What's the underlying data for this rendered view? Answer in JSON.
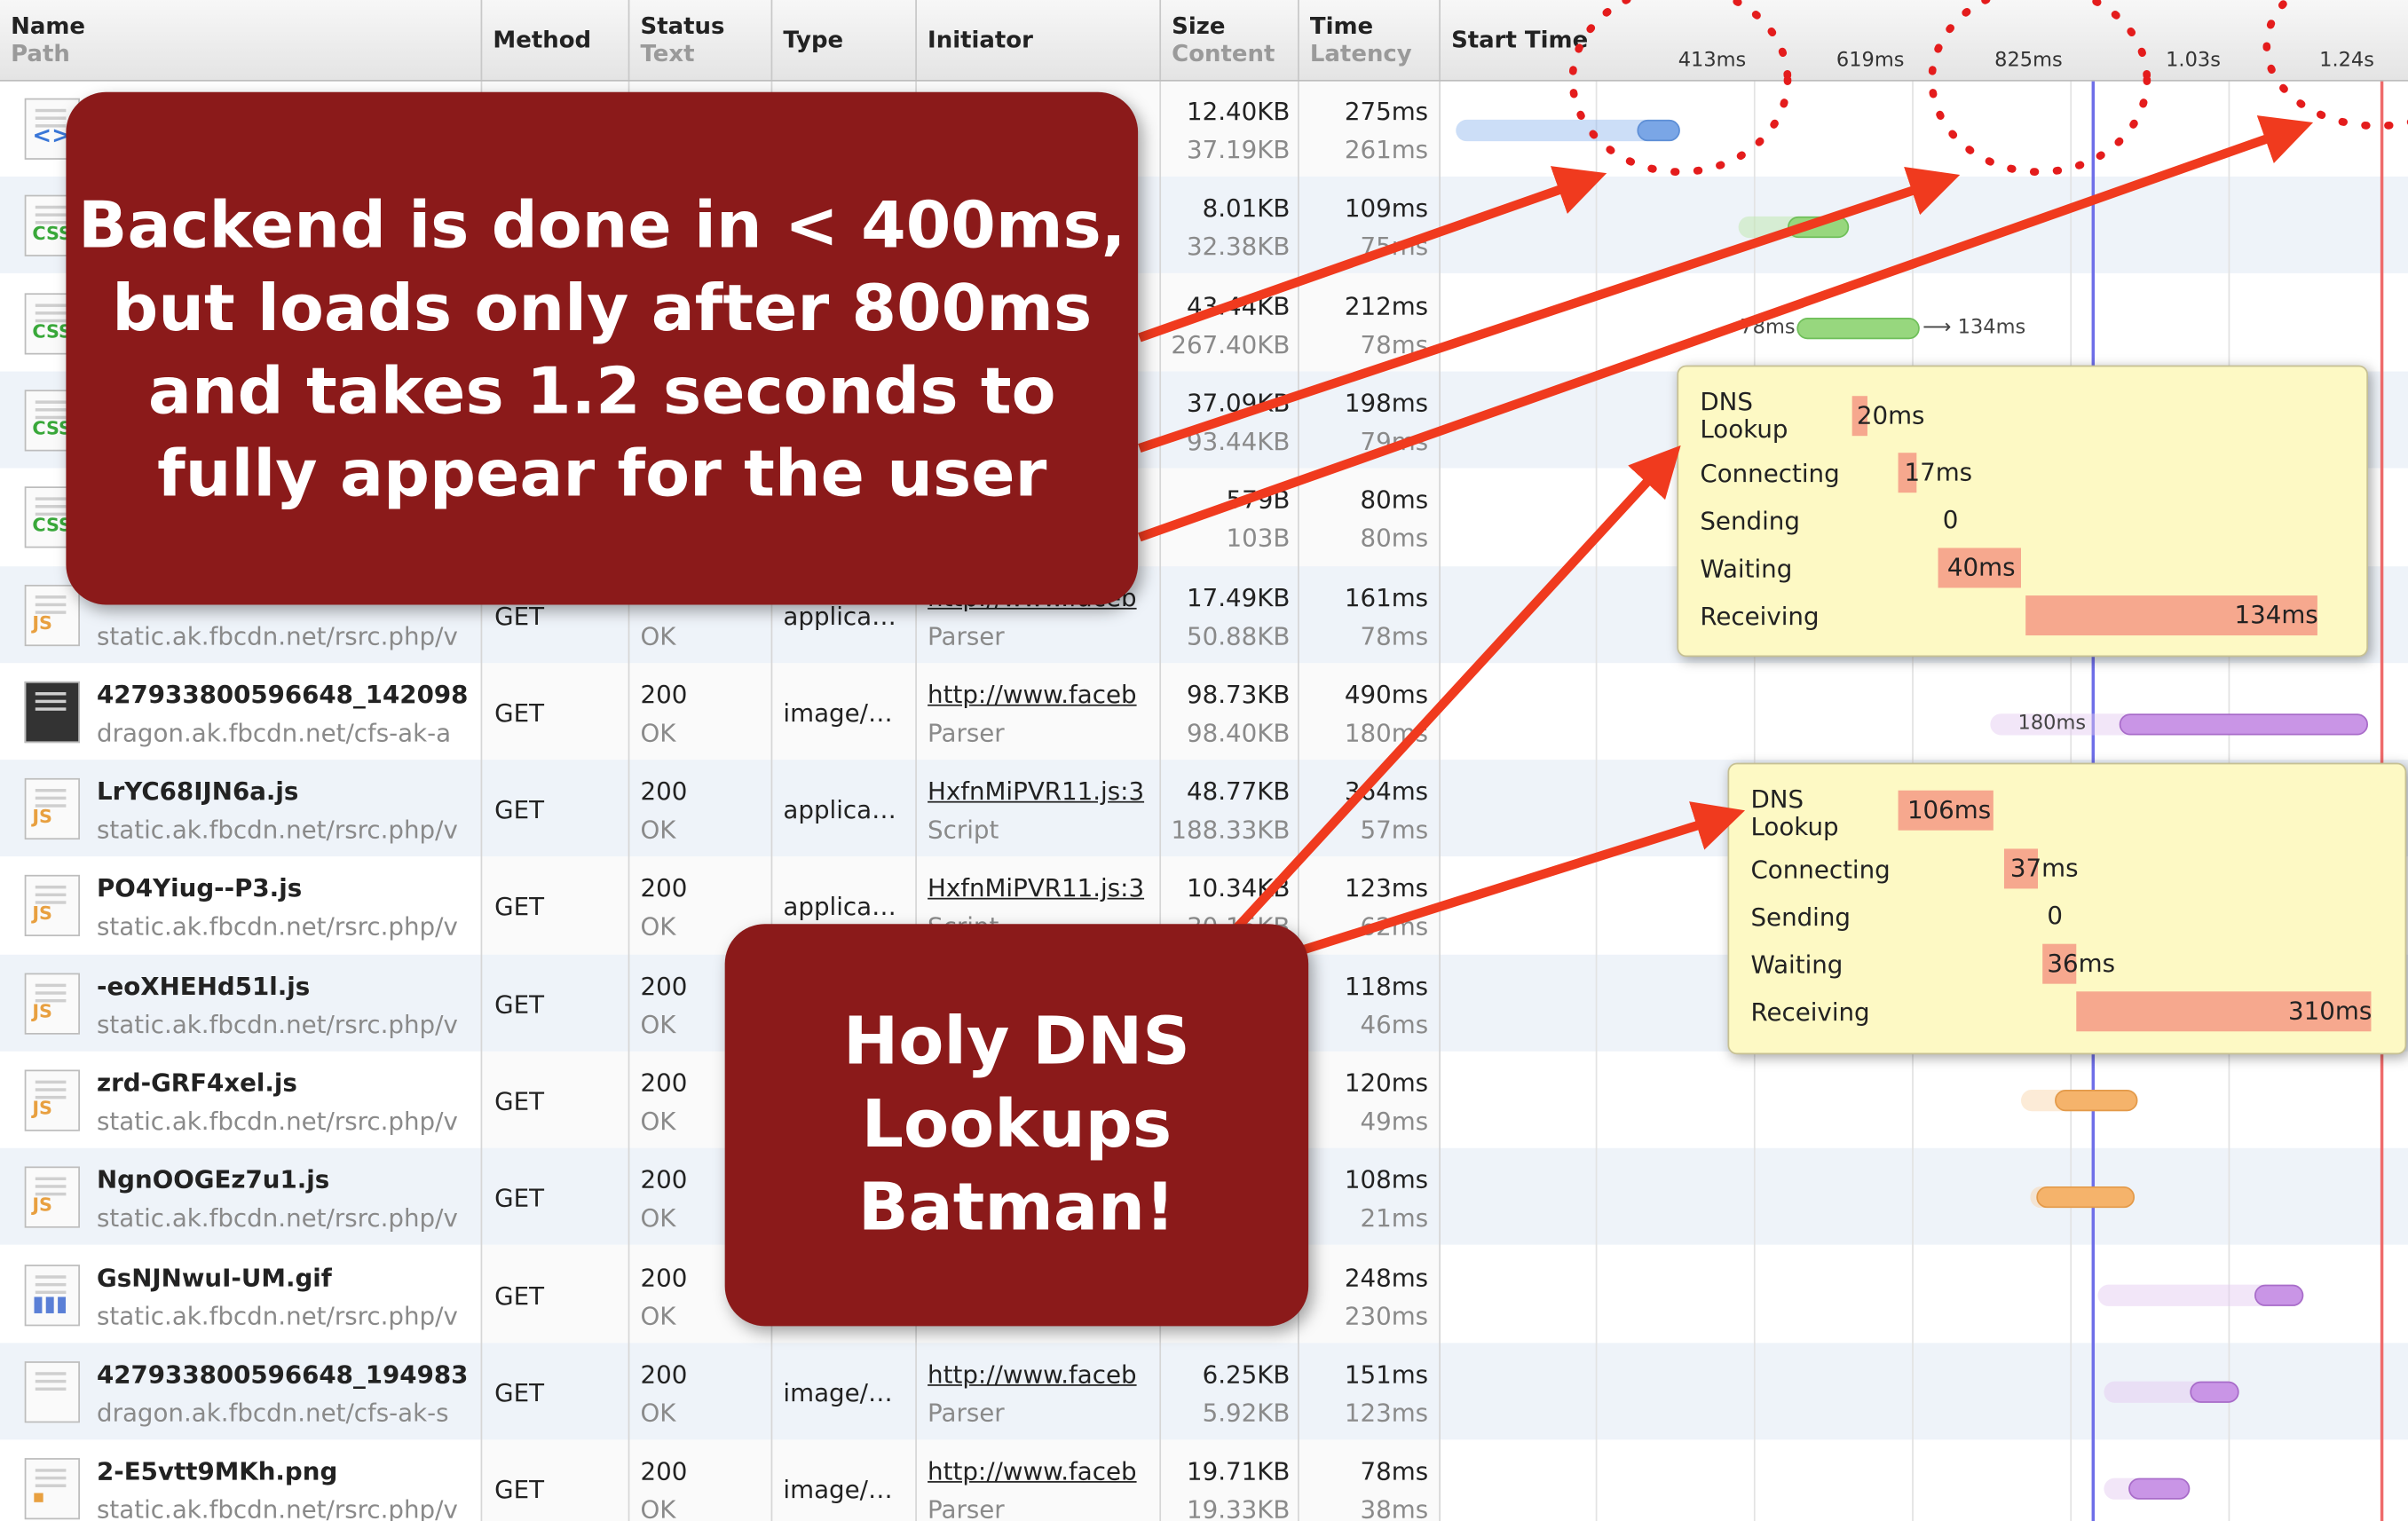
{
  "header": {
    "name": "Name",
    "path": "Path",
    "method": "Method",
    "status": "Status",
    "status_text": "Text",
    "type": "Type",
    "initiator": "Initiator",
    "size": "Size",
    "content": "Content",
    "time": "Time",
    "latency": "Latency",
    "start_time": "Start Time",
    "ticks": [
      "413ms",
      "619ms",
      "825ms",
      "1.03s",
      "1.24s"
    ]
  },
  "rows": [
    {
      "icon": "html-file-icon",
      "name": "",
      "path": "",
      "method": "",
      "status": "",
      "status_text": "",
      "type": "",
      "init1": "",
      "init2": "",
      "size": "12.40KB",
      "content": "37.19KB",
      "time": "275ms",
      "latency": "261ms"
    },
    {
      "icon": "css-file-icon",
      "name": "",
      "path": "",
      "method": "",
      "status": "",
      "status_text": "",
      "type": "",
      "init1": "",
      "init2": "",
      "size": "8.01KB",
      "content": "32.38KB",
      "time": "109ms",
      "latency": "75ms"
    },
    {
      "icon": "css-file-icon",
      "name": "",
      "path": "",
      "method": "",
      "status": "",
      "status_text": "",
      "type": "",
      "init1": "",
      "init2": "",
      "size": "43.44KB",
      "content": "267.40KB",
      "time": "212ms",
      "latency": "78ms"
    },
    {
      "icon": "css-file-icon",
      "name": "",
      "path": "",
      "method": "",
      "status": "",
      "status_text": "",
      "type": "",
      "init1": "",
      "init2": "",
      "size": "37.09KB",
      "content": "93.44KB",
      "time": "198ms",
      "latency": "79ms"
    },
    {
      "icon": "css-file-icon",
      "name": "",
      "path": "",
      "method": "",
      "status": "",
      "status_text": "",
      "type": "",
      "init1": "",
      "init2": "",
      "size": "579B",
      "content": "103B",
      "time": "80ms",
      "latency": "80ms"
    },
    {
      "icon": "js-file-icon",
      "name": "",
      "path": "static.ak.fbcdn.net/rsrc.php/v",
      "method": "GET",
      "status": "",
      "status_text": "OK",
      "type": "applica…",
      "init1": "http://www.faceb",
      "init2": "Parser",
      "size": "17.49KB",
      "content": "50.88KB",
      "time": "161ms",
      "latency": "78ms"
    },
    {
      "icon": "image-file-icon",
      "name": "427933800596648_142098",
      "path": "dragon.ak.fbcdn.net/cfs-ak-a",
      "method": "GET",
      "status": "200",
      "status_text": "OK",
      "type": "image/…",
      "init1": "http://www.faceb",
      "init2": "Parser",
      "size": "98.73KB",
      "content": "98.40KB",
      "time": "490ms",
      "latency": "180ms"
    },
    {
      "icon": "js-file-icon",
      "name": "LrYC68IJN6a.js",
      "path": "static.ak.fbcdn.net/rsrc.php/v",
      "method": "GET",
      "status": "200",
      "status_text": "OK",
      "type": "applica…",
      "init1": "HxfnMiPVR11.js:3",
      "init2": "Script",
      "size": "48.77KB",
      "content": "188.33KB",
      "time": "364ms",
      "latency": "57ms"
    },
    {
      "icon": "js-file-icon",
      "name": "PO4Yiug--P3.js",
      "path": "static.ak.fbcdn.net/rsrc.php/v",
      "method": "GET",
      "status": "200",
      "status_text": "OK",
      "type": "applica…",
      "init1": "HxfnMiPVR11.js:3",
      "init2": "Script",
      "size": "10.34KB",
      "content": "30.15KB",
      "time": "123ms",
      "latency": "62ms"
    },
    {
      "icon": "js-file-icon",
      "name": "-eoXHEHd51l.js",
      "path": "static.ak.fbcdn.net/rsrc.php/v",
      "method": "GET",
      "status": "200",
      "status_text": "OK",
      "type": "",
      "init1": "",
      "init2": "",
      "size": "",
      "content": "",
      "time": "118ms",
      "latency": "46ms"
    },
    {
      "icon": "js-file-icon",
      "name": "zrd-GRF4xel.js",
      "path": "static.ak.fbcdn.net/rsrc.php/v",
      "method": "GET",
      "status": "200",
      "status_text": "OK",
      "type": "",
      "init1": "",
      "init2": "",
      "size": "",
      "content": "",
      "time": "120ms",
      "latency": "49ms"
    },
    {
      "icon": "js-file-icon",
      "name": "NgnOOGEz7u1.js",
      "path": "static.ak.fbcdn.net/rsrc.php/v",
      "method": "GET",
      "status": "200",
      "status_text": "OK",
      "type": "",
      "init1": "",
      "init2": "",
      "size": "",
      "content": "",
      "time": "108ms",
      "latency": "21ms"
    },
    {
      "icon": "gif-file-icon",
      "name": "GsNJNwuI-UM.gif",
      "path": "static.ak.fbcdn.net/rsrc.php/v",
      "method": "GET",
      "status": "200",
      "status_text": "OK",
      "type": "",
      "init1": "",
      "init2": "",
      "size": "",
      "content": "",
      "time": "248ms",
      "latency": "230ms"
    },
    {
      "icon": "blank-file-icon",
      "name": "427933800596648_194983",
      "path": "dragon.ak.fbcdn.net/cfs-ak-s",
      "method": "GET",
      "status": "200",
      "status_text": "OK",
      "type": "image/…",
      "init1": "http://www.faceb",
      "init2": "Parser",
      "size": "6.25KB",
      "content": "5.92KB",
      "time": "151ms",
      "latency": "123ms"
    },
    {
      "icon": "png-file-icon",
      "name": "2-E5vtt9MKh.png",
      "path": "static.ak.fbcdn.net/rsrc.php/v",
      "method": "GET",
      "status": "200",
      "status_text": "OK",
      "type": "image/…",
      "init1": "http://www.faceb",
      "init2": "Parser",
      "size": "19.71KB",
      "content": "19.33KB",
      "time": "78ms",
      "latency": "38ms"
    }
  ],
  "waterfall": {
    "bar_labels": {
      "css_latency": "78ms",
      "css_receive": "134ms",
      "img_latency": "180ms"
    }
  },
  "tooltip1": {
    "dns_label_1": "DNS",
    "dns_label_2": "Lookup",
    "dns": "20ms",
    "connecting_label": "Connecting",
    "connecting": "17ms",
    "sending_label": "Sending",
    "sending": "0",
    "waiting_label": "Waiting",
    "waiting": "40ms",
    "receiving_label": "Receiving",
    "receiving": "134ms"
  },
  "tooltip2": {
    "dns_label_1": "DNS",
    "dns_label_2": "Lookup",
    "dns": "106ms",
    "connecting_label": "Connecting",
    "connecting": "37ms",
    "sending_label": "Sending",
    "sending": "0",
    "waiting_label": "Waiting",
    "waiting": "36ms",
    "receiving_label": "Receiving",
    "receiving": "310ms"
  },
  "callout_backend": {
    "line1": "Backend is done in < 400ms,",
    "line2": "but loads only after 800ms",
    "line3": "and takes 1.2 seconds to",
    "line4": "fully appear for the user"
  },
  "callout_dns": {
    "line1": "Holy DNS",
    "line2": "Lookups",
    "line3": "Batman!"
  },
  "colors": {
    "callout_bg": "#8b1a1a",
    "arrow": "#f03a1e",
    "tooltip_bg": "#fdf9c4",
    "tooltip_segment": "#f6a88e",
    "row_alt": "#eef3f9"
  }
}
